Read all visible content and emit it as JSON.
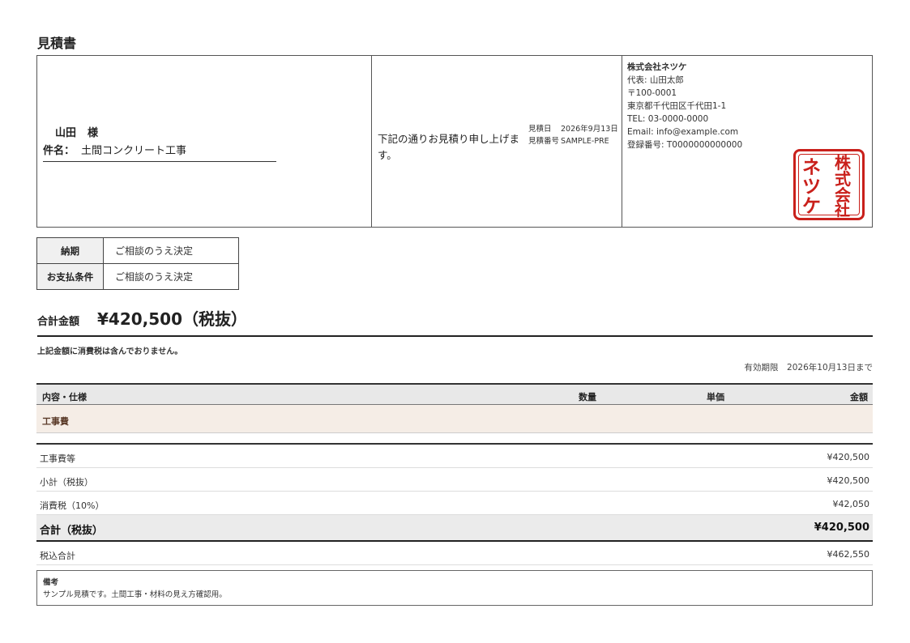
{
  "document": {
    "title": "見積書",
    "recipient": {
      "name": "山田",
      "honorific": "様"
    },
    "subject": {
      "label": "件名：",
      "value": "土間コンクリート工事"
    },
    "greeting": "下記の通りお見積り申し上げます。",
    "meta": {
      "date_label": "見積日",
      "date_value": "2026年9月13日",
      "number_label": "見積番号",
      "number_value": "SAMPLE-PRE"
    },
    "company": {
      "name": "株式会社ネツケ",
      "rep": "代表: 山田太郎",
      "postal": "〒100-0001",
      "address": "東京都千代田区千代田1-1",
      "tel": "TEL: 03-0000-0000",
      "email": "Email: info@example.com",
      "reg": "登録番号: T0000000000000"
    },
    "stamp": {
      "text": "株式会社ネツケ",
      "color": "#c9201b"
    },
    "terms": [
      {
        "key": "納期",
        "value": "ご相談のうえ決定"
      },
      {
        "key": "お支払条件",
        "value": "ご相談のうえ決定"
      }
    ],
    "total": {
      "label": "合計金額",
      "amount": "¥420,500（税抜）"
    },
    "tax_note": "上記金額に消費税は含んでおりません。",
    "validity": "有効期限　2026年10月13日まで",
    "items_header": {
      "desc": "内容・仕様",
      "qty": "数量",
      "unit": "単価",
      "amount": "金額"
    },
    "section": "工事費",
    "summary": [
      {
        "label": "工事費等",
        "value": "¥420,500"
      },
      {
        "label": "小計（税抜）",
        "value": "¥420,500"
      },
      {
        "label": "消費税（10%）",
        "value": "¥42,050"
      }
    ],
    "grand": {
      "label": "合計（税抜）",
      "value": "¥420,500"
    },
    "incl": {
      "label": "税込合計",
      "value": "¥462,550"
    },
    "notes": {
      "title": "備考",
      "text": "サンプル見積です。土間工事・材料の見え方確認用。"
    }
  }
}
